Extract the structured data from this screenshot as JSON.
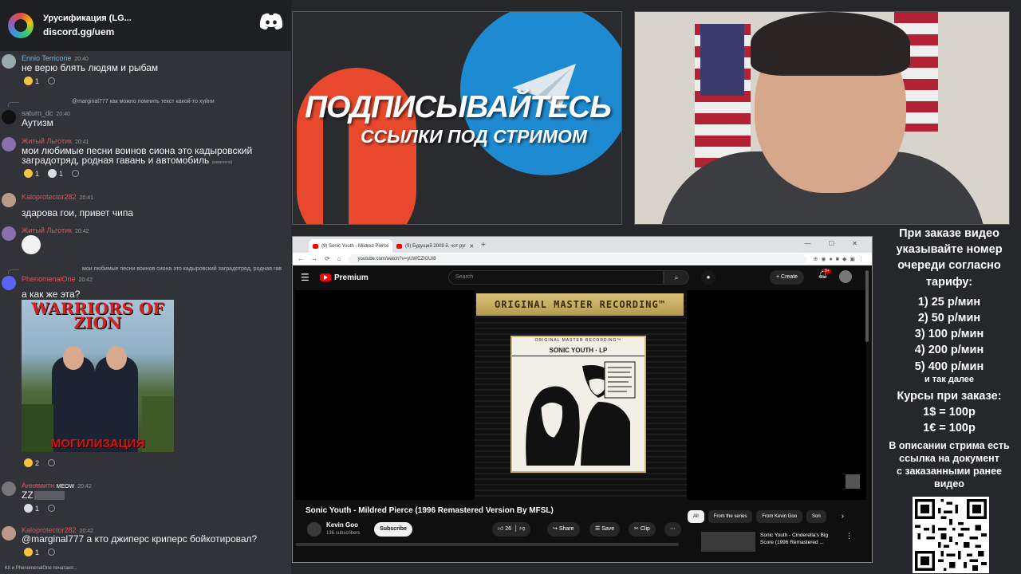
{
  "chat": {
    "server_name": "Урусификация (LG...",
    "invite": "discord.gg/uem",
    "messages": [
      {
        "user": "Ennio Terricone",
        "time": "20:40",
        "text": "не верю блять людям и рыбам",
        "reactions": [
          "1"
        ]
      },
      {
        "reply": "@marginal777 как можно помнить текст какой-то хуйни",
        "user": "saturn_dc",
        "time": "20:40",
        "text": "Аутизм"
      },
      {
        "user": "Житый Льготик",
        "time": "20:41",
        "text1": "мои любимые песни воинов сиона это кадыровский",
        "text2": "заградотряд, родная гавань и автомобиль",
        "edited": "(изменено)",
        "reactions": [
          "1",
          "1"
        ]
      },
      {
        "user": "Kaloprotector282",
        "time": "20:41",
        "text": "здарова гои, привет чипа"
      },
      {
        "user": "Житый Льготик",
        "time": "20:42"
      },
      {
        "reply": "мои любимые песни воинов сиона это кадыровский заградотряд, родная гав",
        "user": "PhenomenalOne",
        "time": "20:42",
        "text": "а как же эта?",
        "meme_top": "WARRIORS OF ZION",
        "meme_bottom": "МОГИЛИЗАЦИЯ",
        "reactions": [
          "2"
        ]
      },
      {
        "user": "Аннямитн",
        "badge": "MEOW",
        "time": "20:42",
        "text": "ZZ",
        "reactions": [
          "1"
        ]
      },
      {
        "user": "Kaloprotector282",
        "time": "20:42",
        "text": "@marginal777 а кто джиперс криперс бойкотировал?",
        "reactions": [
          "1"
        ]
      }
    ],
    "typing": "Kit и PhenomenalOne печатают..."
  },
  "banner": {
    "line1": "ПОДПИСЫВАЙТЕСЬ",
    "line2": "ССЫЛКИ ПОД СТРИМОМ"
  },
  "browser": {
    "tabs": [
      {
        "label": "(9) Sonic Youth - Mildred Pierce",
        "active": true
      },
      {
        "label": "(9) Будущий 2009 й, чот руг",
        "active": false
      }
    ],
    "url": "youtube.com/watch?v=yUWCZlGUI8",
    "window_controls": "— ☐ ✕"
  },
  "youtube": {
    "logo": "Premium",
    "search_placeholder": "Search",
    "create": "+ Create",
    "bell_badge": "9+",
    "player_banner": "ORIGINAL MASTER RECORDING™",
    "album_top": "ORIGINAL MASTER RECORDING™",
    "album_artist": "SONIC YOUTH · LP",
    "video_title": "Sonic Youth - Mildred Pierce (1996 Remastered Version By MFSL)",
    "channel": "Kevin Goo",
    "subs": "136 subscribers",
    "subscribe": "Subscribe",
    "likes": "26",
    "share": "Share",
    "save": "Save",
    "clip": "Clip",
    "chips": [
      "All",
      "From the series",
      "From Kevin Goo",
      "Son"
    ],
    "rec_title": "Sonic Youth - Cinderella's Big Score (1996 Remastered ..."
  },
  "info": {
    "l1": "При заказе видео",
    "l2": "указывайте номер",
    "l3": "очереди согласно",
    "l4": "тарифу:",
    "p1": "1) 25 р/мин",
    "p2": "2) 50 р/мин",
    "p3": "3) 100 р/мин",
    "p4": "4) 200 р/мин",
    "p5": "5) 400 р/мин",
    "etc": "и так далее",
    "c1": "Курсы при заказе:",
    "c2": "1$ = 100р",
    "c3": "1€ = 100р",
    "d1": "В описании стрима есть",
    "d2": "ссылка на документ",
    "d3": "с заказанными ранее",
    "d4": "видео"
  },
  "colors": {
    "discord_bg": "#313338",
    "patreon": "#e8492d",
    "telegram": "#1e8ad1",
    "yt_red": "#ff0000"
  }
}
